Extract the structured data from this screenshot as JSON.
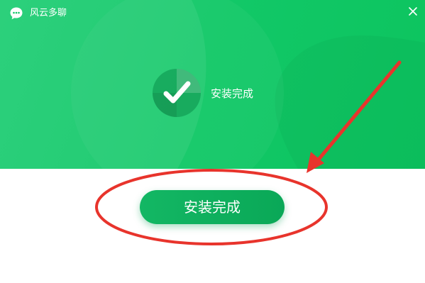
{
  "window": {
    "title": "风云多聊",
    "close_icon": "close-icon",
    "app_icon": "chat-bubble-icon"
  },
  "status": {
    "icon": "checkmark-icon",
    "text": "安装完成"
  },
  "actions": {
    "finish_label": "安装完成"
  },
  "annotation": {
    "type": "red-ellipse-and-arrow",
    "color": "#e8342c"
  },
  "colors": {
    "header_green": "#12c868",
    "button_green": "#0fb05e",
    "annotation_red": "#e8342c"
  }
}
